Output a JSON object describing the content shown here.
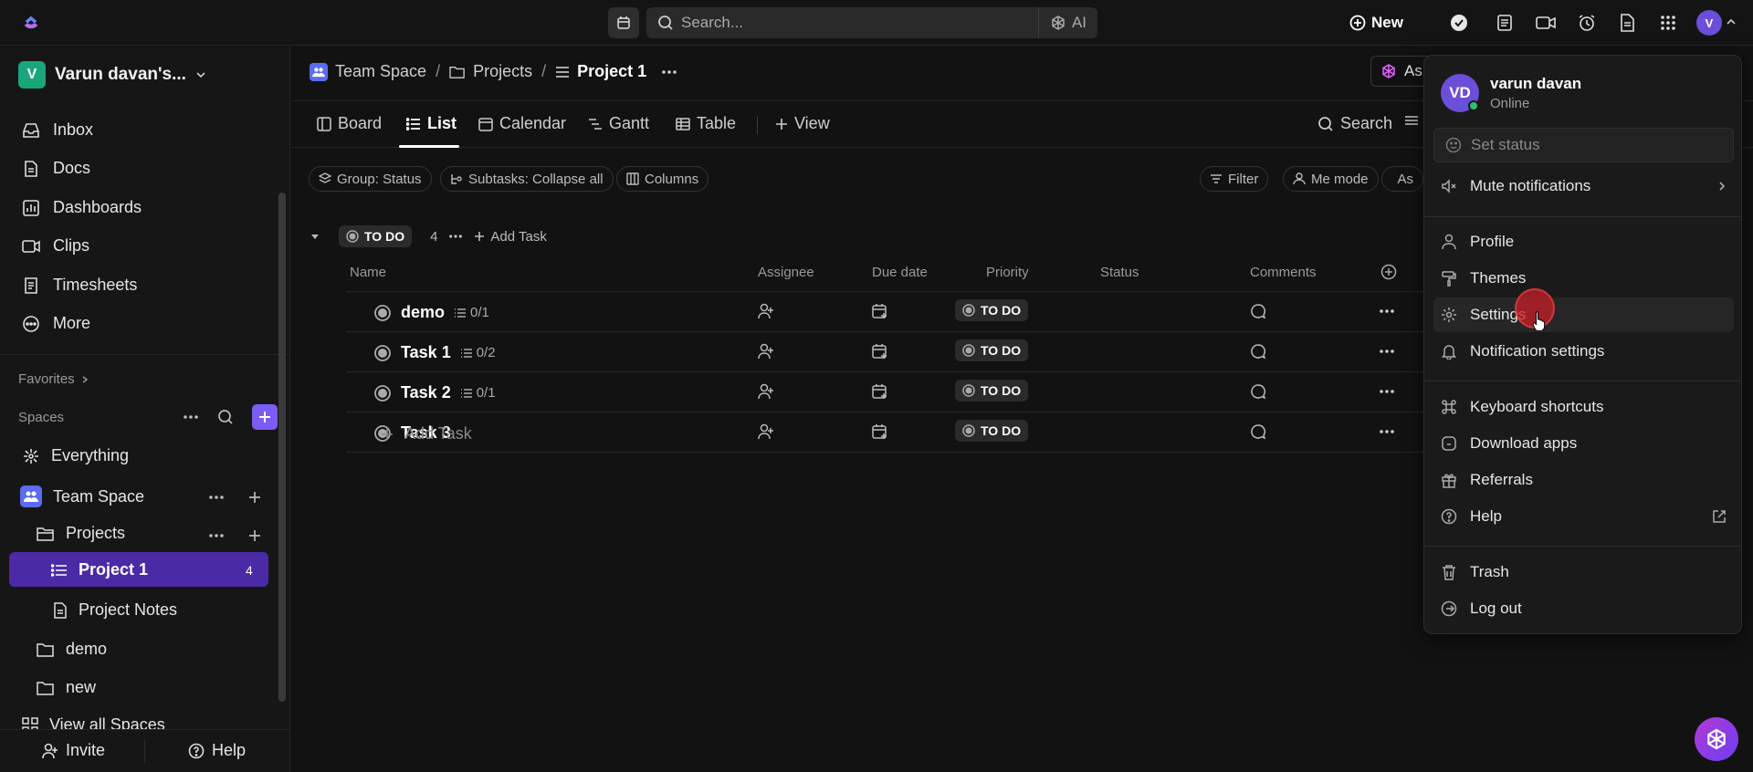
{
  "topbar": {
    "search_placeholder": "Search...",
    "ai_label": "AI",
    "new_label": "New",
    "avatar_initial": "V"
  },
  "sidebar": {
    "workspace_initial": "V",
    "workspace_name": "Varun davan's...",
    "nav": [
      "Inbox",
      "Docs",
      "Dashboards",
      "Clips",
      "Timesheets",
      "More"
    ],
    "favorites_label": "Favorites",
    "spaces_label": "Spaces",
    "tree": {
      "everything": "Everything",
      "team_space": "Team Space",
      "projects": "Projects",
      "project1": "Project 1",
      "project1_count": "4",
      "project_notes": "Project Notes",
      "demo": "demo",
      "new": "new",
      "view_all": "View all Spaces"
    },
    "footer": {
      "invite": "Invite",
      "help": "Help"
    }
  },
  "main": {
    "breadcrumb": [
      "Team Space",
      "Projects",
      "Project 1"
    ],
    "ask_label": "Ask",
    "tabs": [
      "Board",
      "List",
      "Calendar",
      "Gantt",
      "Table",
      "View"
    ],
    "search_label": "Search",
    "chips": [
      "Group: Status",
      "Subtasks: Collapse all",
      "Columns"
    ],
    "right_chips": [
      "Filter",
      "Me mode",
      "As"
    ],
    "group": {
      "status": "TO DO",
      "count": "4",
      "add_task": "Add Task"
    },
    "columns": [
      "Name",
      "Assignee",
      "Due date",
      "Priority",
      "Status",
      "Comments"
    ],
    "rows": [
      {
        "name": "demo",
        "subtasks": "0/1",
        "status": "TO DO"
      },
      {
        "name": "Task 1",
        "subtasks": "0/2",
        "status": "TO DO"
      },
      {
        "name": "Task 2",
        "subtasks": "0/1",
        "status": "TO DO"
      },
      {
        "name": "Task 3",
        "subtasks": "",
        "status": "TO DO"
      }
    ],
    "add_task_bottom": "Add Task"
  },
  "menu": {
    "avatar_initials": "VD",
    "user_name": "varun davan",
    "presence": "Online",
    "set_status_placeholder": "Set status",
    "mute": "Mute notifications",
    "items_a": [
      "Profile",
      "Themes",
      "Settings",
      "Notification settings"
    ],
    "items_b": [
      "Keyboard shortcuts",
      "Download apps",
      "Referrals",
      "Help"
    ],
    "items_c": [
      "Trash",
      "Log out"
    ]
  },
  "colors": {
    "accent": "#7b5cf5",
    "active_row": "#4b2aa6",
    "workspace_badge": "#19a77a",
    "online": "#2fbf71"
  }
}
